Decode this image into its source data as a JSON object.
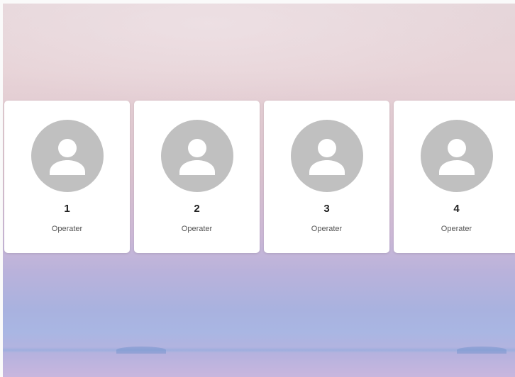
{
  "operators": [
    {
      "number": "1",
      "role": "Operater",
      "avatar_icon": "person-icon"
    },
    {
      "number": "2",
      "role": "Operater",
      "avatar_icon": "person-icon"
    },
    {
      "number": "3",
      "role": "Operater",
      "avatar_icon": "person-icon"
    },
    {
      "number": "4",
      "role": "Operater",
      "avatar_icon": "person-icon"
    }
  ],
  "colors": {
    "card_background": "#ffffff",
    "avatar_background": "#c0c0c0",
    "avatar_glyph": "#ffffff",
    "wallpaper_top": "#e6d6da",
    "wallpaper_bottom": "#a9b6e3"
  }
}
